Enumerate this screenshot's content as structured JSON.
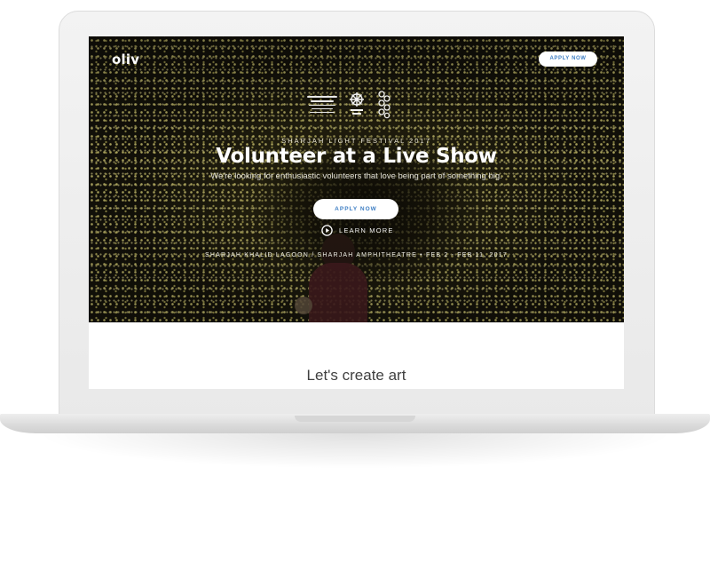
{
  "site": {
    "logo_text": "oliv",
    "nav_apply_label": "APPLY NOW"
  },
  "hero": {
    "festival_label": "SHARJAH LIGHT FESTIVAL 2017",
    "headline": "Volunteer at a Live Show",
    "subline": "We're looking for enthusiastic volunteers that love being part of something big.",
    "cta_apply_label": "APPLY NOW",
    "learn_more_label": "LEARN MORE",
    "venue_line": "SHARJAH KHALID LAGOON / SHARJAH AMPHITHEATRE • FEB 2 - FEB 11, 2017",
    "sponsor_icons": [
      "government-of-sharjah-logo",
      "sharjah-emblem-logo",
      "light-festival-circles-logo"
    ]
  },
  "content": {
    "section_title": "Let's create art"
  },
  "colors": {
    "accent_blue": "#3f7fc4",
    "hero_bg": "#15130b",
    "laptop_silver": "#ececec",
    "light_gold": "#ebe182"
  }
}
